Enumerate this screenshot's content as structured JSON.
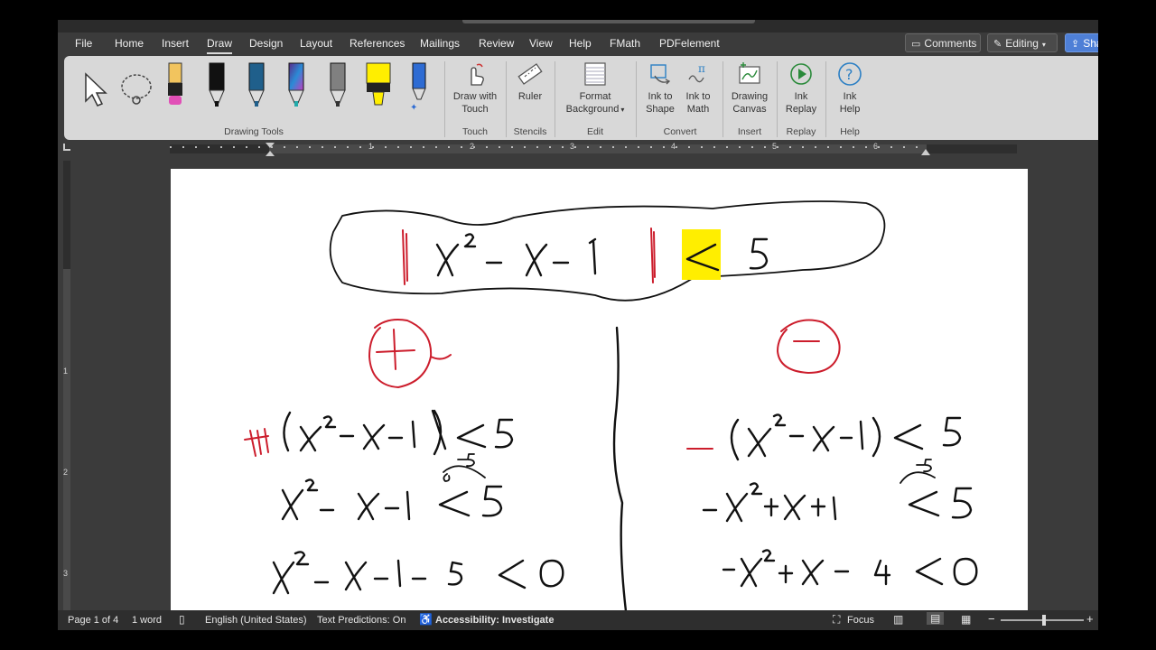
{
  "menu": {
    "tabs": [
      "File",
      "Home",
      "Insert",
      "Draw",
      "Design",
      "Layout",
      "References",
      "Mailings",
      "Review",
      "View",
      "Help",
      "FMath",
      "PDFelement"
    ],
    "active_tab": "Draw",
    "comments_label": "Comments",
    "editing_label": "Editing",
    "share_label": "Sha"
  },
  "ribbon": {
    "drawing_tools_label": "Drawing Tools",
    "draw_with_touch": [
      "Draw with",
      "Touch"
    ],
    "touch_label": "Touch",
    "ruler": "Ruler",
    "stencils_label": "Stencils",
    "format_background": [
      "Format",
      "Background"
    ],
    "edit_label": "Edit",
    "ink_to_shape": [
      "Ink to",
      "Shape"
    ],
    "ink_to_math": [
      "Ink to",
      "Math"
    ],
    "convert_label": "Convert",
    "drawing_canvas": [
      "Drawing",
      "Canvas"
    ],
    "insert_label": "Insert",
    "ink_replay": [
      "Ink",
      "Replay"
    ],
    "replay_label": "Replay",
    "ink_help": [
      "Ink",
      "Help"
    ],
    "help_label": "Help",
    "pen_colors": [
      "#111111",
      "#111111",
      "#1f5f8b",
      "#5a2a8a",
      "#808080",
      "#ffee00",
      "#2d6bd3"
    ]
  },
  "ruler": {
    "numbers": [
      "1",
      "2",
      "3",
      "4",
      "5",
      "6"
    ]
  },
  "vruler": {
    "numbers": [
      "1",
      "2",
      "3"
    ]
  },
  "status": {
    "page": "Page 1 of 4",
    "words": "1 word",
    "language": "English (United States)",
    "text_predictions": "Text Predictions: On",
    "accessibility": "Accessibility: Investigate",
    "focus": "Focus"
  },
  "colors": {
    "accent_highlight": "#ffee00",
    "red_ink": "#cc1d2c"
  }
}
